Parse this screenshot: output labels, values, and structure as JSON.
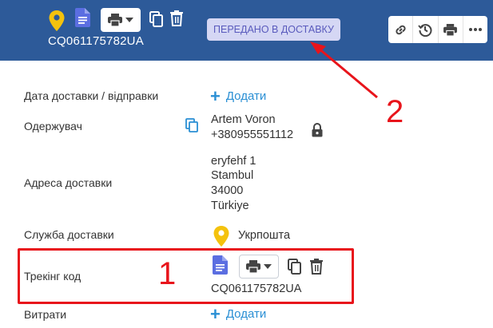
{
  "header": {
    "tracking_code": "CQ061175782UA",
    "status_badge": "ПЕРЕДАНО В ДОСТАВКУ",
    "actions": [
      "link-icon",
      "history-icon",
      "print-icon",
      "more-icon"
    ]
  },
  "fields": {
    "delivery_date": {
      "label": "Дата доставки / відправки",
      "add": "Додати"
    },
    "recipient": {
      "label": "Одержувач",
      "name": "Artem Voron",
      "phone": "+380955551112"
    },
    "address": {
      "label": "Адреса доставки",
      "lines": [
        "eryfehf 1",
        "Stambul",
        "34000",
        "Türkiye"
      ]
    },
    "service": {
      "label": "Служба доставки",
      "name": "Укрпошта"
    },
    "tracking": {
      "label": "Трекінг код",
      "code": "CQ061175782UA"
    },
    "costs": {
      "label": "Витрати",
      "add": "Додати"
    }
  },
  "annotations": {
    "marker_1": "1",
    "marker_2": "2"
  },
  "colors": {
    "header_bg": "#2d5a99",
    "accent": "#2a8fd4",
    "badge_bg": "#d5d7f4",
    "badge_text": "#5a5bbd",
    "annotation": "#e8141b",
    "pin": "#f4c20d",
    "doc": "#5b6ee1"
  }
}
